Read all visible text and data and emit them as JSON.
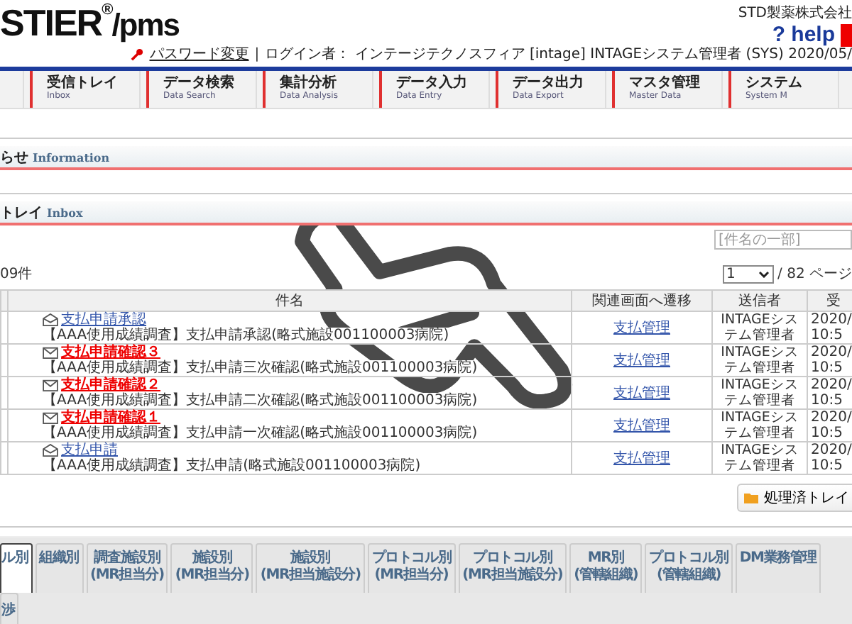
{
  "header": {
    "logo": "STIER",
    "logo_mark": "®",
    "logo_suffix": "/pms",
    "company": "STD製薬株式会社",
    "help_mark": "?",
    "help": "help",
    "separator": "|",
    "password_link": "パスワード変更",
    "login_info": "ログイン者： インテージテクノスフィア [intage] INTAGEシステム管理者 (SYS) 2020/05/"
  },
  "nav": [
    {
      "label": "受信トレイ",
      "sub": "Inbox"
    },
    {
      "label": "データ検索",
      "sub": "Data Search"
    },
    {
      "label": "集計分析",
      "sub": "Data Analysis"
    },
    {
      "label": "データ入力",
      "sub": "Data Entry"
    },
    {
      "label": "データ出力",
      "sub": "Data Export"
    },
    {
      "label": "マスタ管理",
      "sub": "Master Data"
    },
    {
      "label": "システム",
      "sub": "System M"
    }
  ],
  "information": {
    "title": "らせ",
    "title_en": "Information"
  },
  "inbox": {
    "title": "トレイ",
    "title_en": "Inbox",
    "search": {
      "placeholder": "[件名の一部]"
    },
    "count": "09件",
    "page": "1",
    "page_total": "/ 82 ページ",
    "columns": [
      "件名",
      "関連画面へ遷移",
      "送信者",
      "受"
    ],
    "rows": [
      {
        "unread": false,
        "title": "支払申請承認",
        "description": "【AAA使用成績調査】支払申請承認(略式施設001100003病院)",
        "related": "支払管理",
        "sender": "INTAGEシステム管理者",
        "date": "2020/",
        "time": "10:5"
      },
      {
        "unread": true,
        "title": "支払申請確認３",
        "description": "【AAA使用成績調査】支払申請三次確認(略式施設001100003病院)",
        "related": "支払管理",
        "sender": "INTAGEシステム管理者",
        "date": "2020/",
        "time": "10:5"
      },
      {
        "unread": true,
        "title": "支払申請確認２",
        "description": "【AAA使用成績調査】支払申請二次確認(略式施設001100003病院)",
        "related": "支払管理",
        "sender": "INTAGEシステム管理者",
        "date": "2020/",
        "time": "10:5"
      },
      {
        "unread": true,
        "title": "支払申請確認１",
        "description": "【AAA使用成績調査】支払申請一次確認(略式施設001100003病院)",
        "related": "支払管理",
        "sender": "INTAGEシステム管理者",
        "date": "2020/",
        "time": "10:5"
      },
      {
        "unread": false,
        "title": "支払申請",
        "description": "【AAA使用成績調査】支払申請(略式施設001100003病院)",
        "related": "支払管理",
        "sender": "INTAGEシステム管理者",
        "date": "2020/",
        "time": "10:5"
      }
    ],
    "processed_button": "処理済トレイ"
  },
  "tabs": [
    {
      "label": "ル別",
      "selected": true
    },
    {
      "label": "組織別",
      "selected": false
    },
    {
      "label": "調査施設別\n(MR担当分)",
      "selected": false
    },
    {
      "label": "施設別\n(MR担当分)",
      "selected": false
    },
    {
      "label": "施設別\n(MR担当施設分)",
      "selected": false
    },
    {
      "label": "プロトコル別\n(MR担当分)",
      "selected": false
    },
    {
      "label": "プロトコル別\n(MR担当施設分)",
      "selected": false
    },
    {
      "label": "MR別\n(管轄組織)",
      "selected": false
    },
    {
      "label": "プロトコル別\n(管轄組織)",
      "selected": false
    },
    {
      "label": "DM業務管理",
      "selected": false
    }
  ],
  "tabs_row2": [
    {
      "label": "渉",
      "selected": false
    }
  ]
}
